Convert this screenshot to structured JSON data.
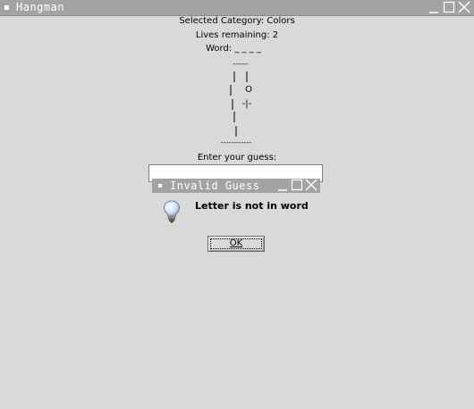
{
  "window": {
    "title": "Hangman"
  },
  "game": {
    "category_line": "Selected Category: Colors",
    "lives_line": "Lives remaining: 2",
    "word_line": "Word: _ _ _ _",
    "gallows_top": "------",
    "gallows_head": "O",
    "gallows_body": "-|-",
    "gallows_base": "------------",
    "prompt": "Enter your guess:"
  },
  "guess_input": {
    "value": ""
  },
  "dialog": {
    "title": "Invalid Guess",
    "message": "Letter is not in word",
    "ok_label": "OK",
    "icon": "lightbulb-icon"
  },
  "colors": {
    "background": "#d9d9d9",
    "titlebar": "#a3a3a3",
    "titlebar_text": "#ffffff"
  }
}
